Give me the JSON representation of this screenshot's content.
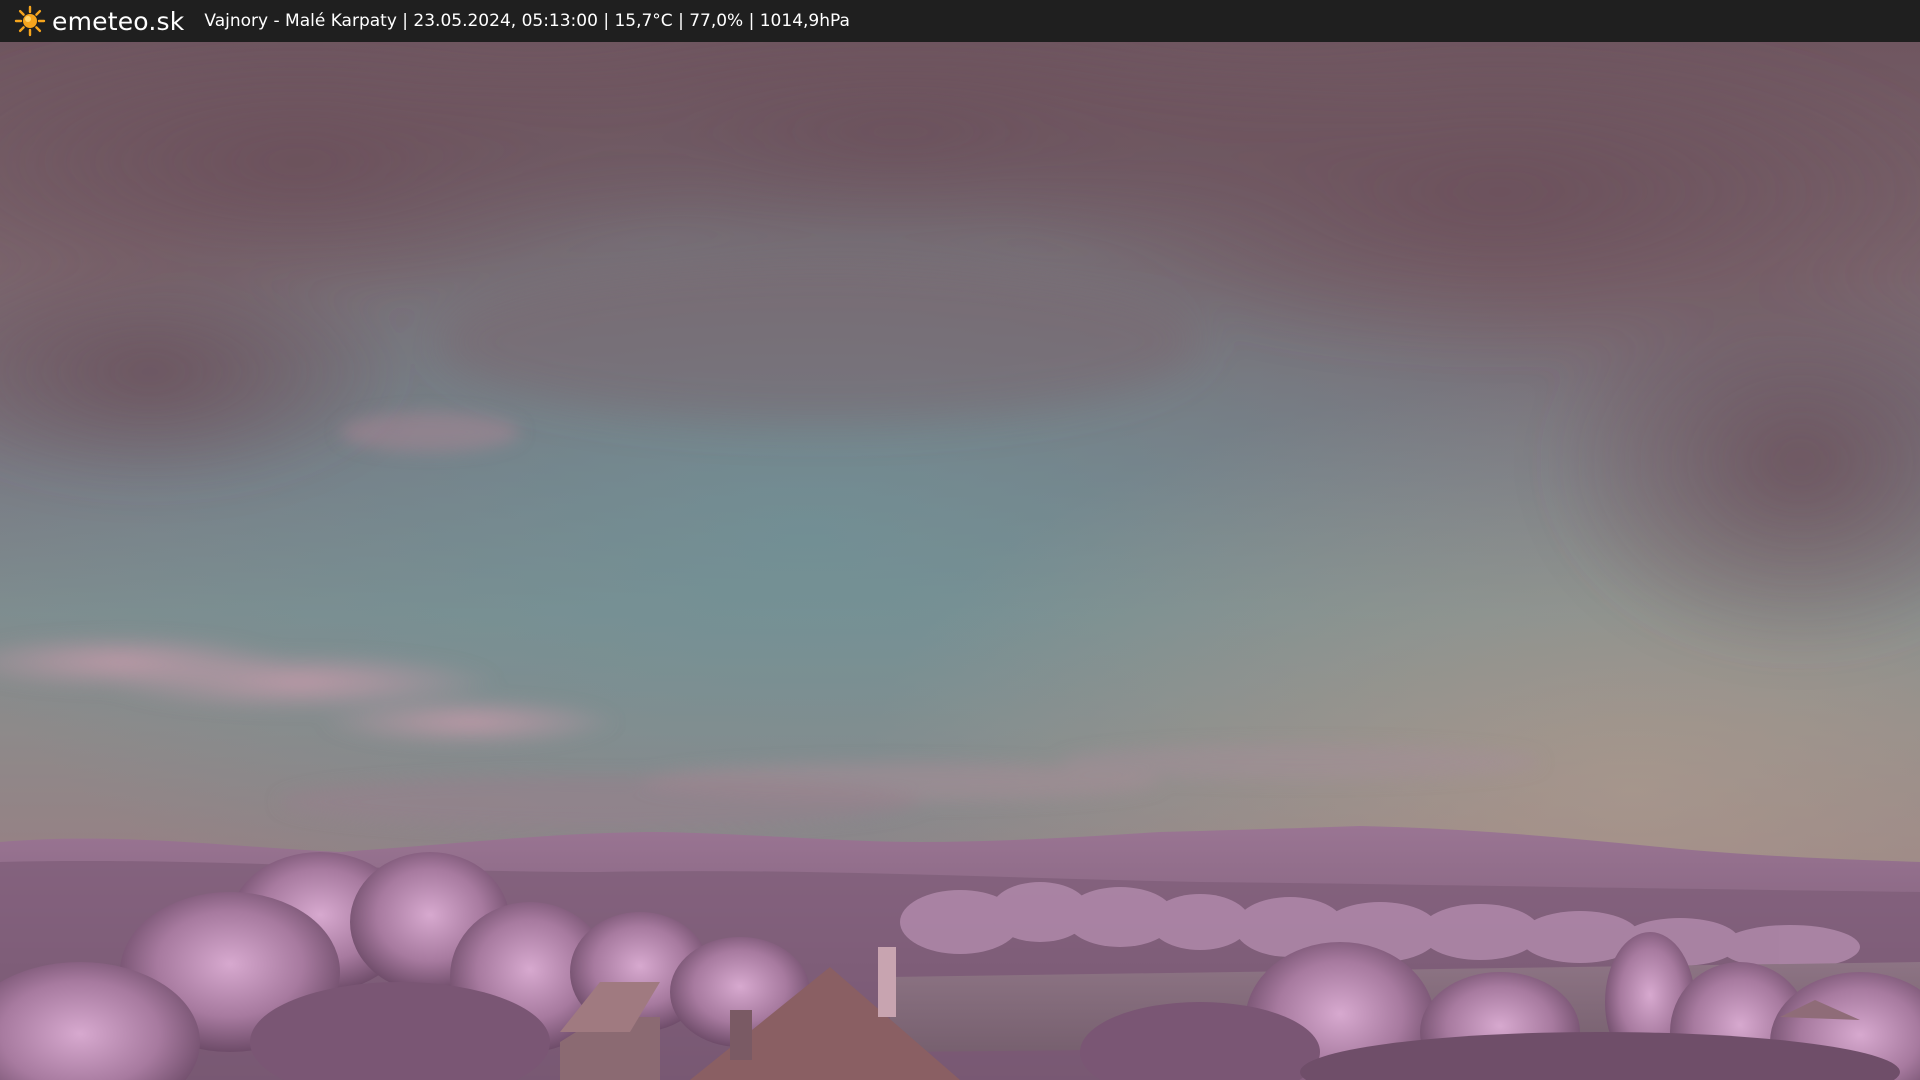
{
  "header": {
    "brand": "emeteo.sk",
    "station": "Vajnory - Malé Karpaty | 23.05.2024, 05:13:00 | 15,7°C | 77,0% | 1014,9hPa"
  },
  "icons": {
    "brand_icon": "sun-icon"
  },
  "colors": {
    "bar_background": "#1f1f1f",
    "sun": "#f6a51d"
  }
}
